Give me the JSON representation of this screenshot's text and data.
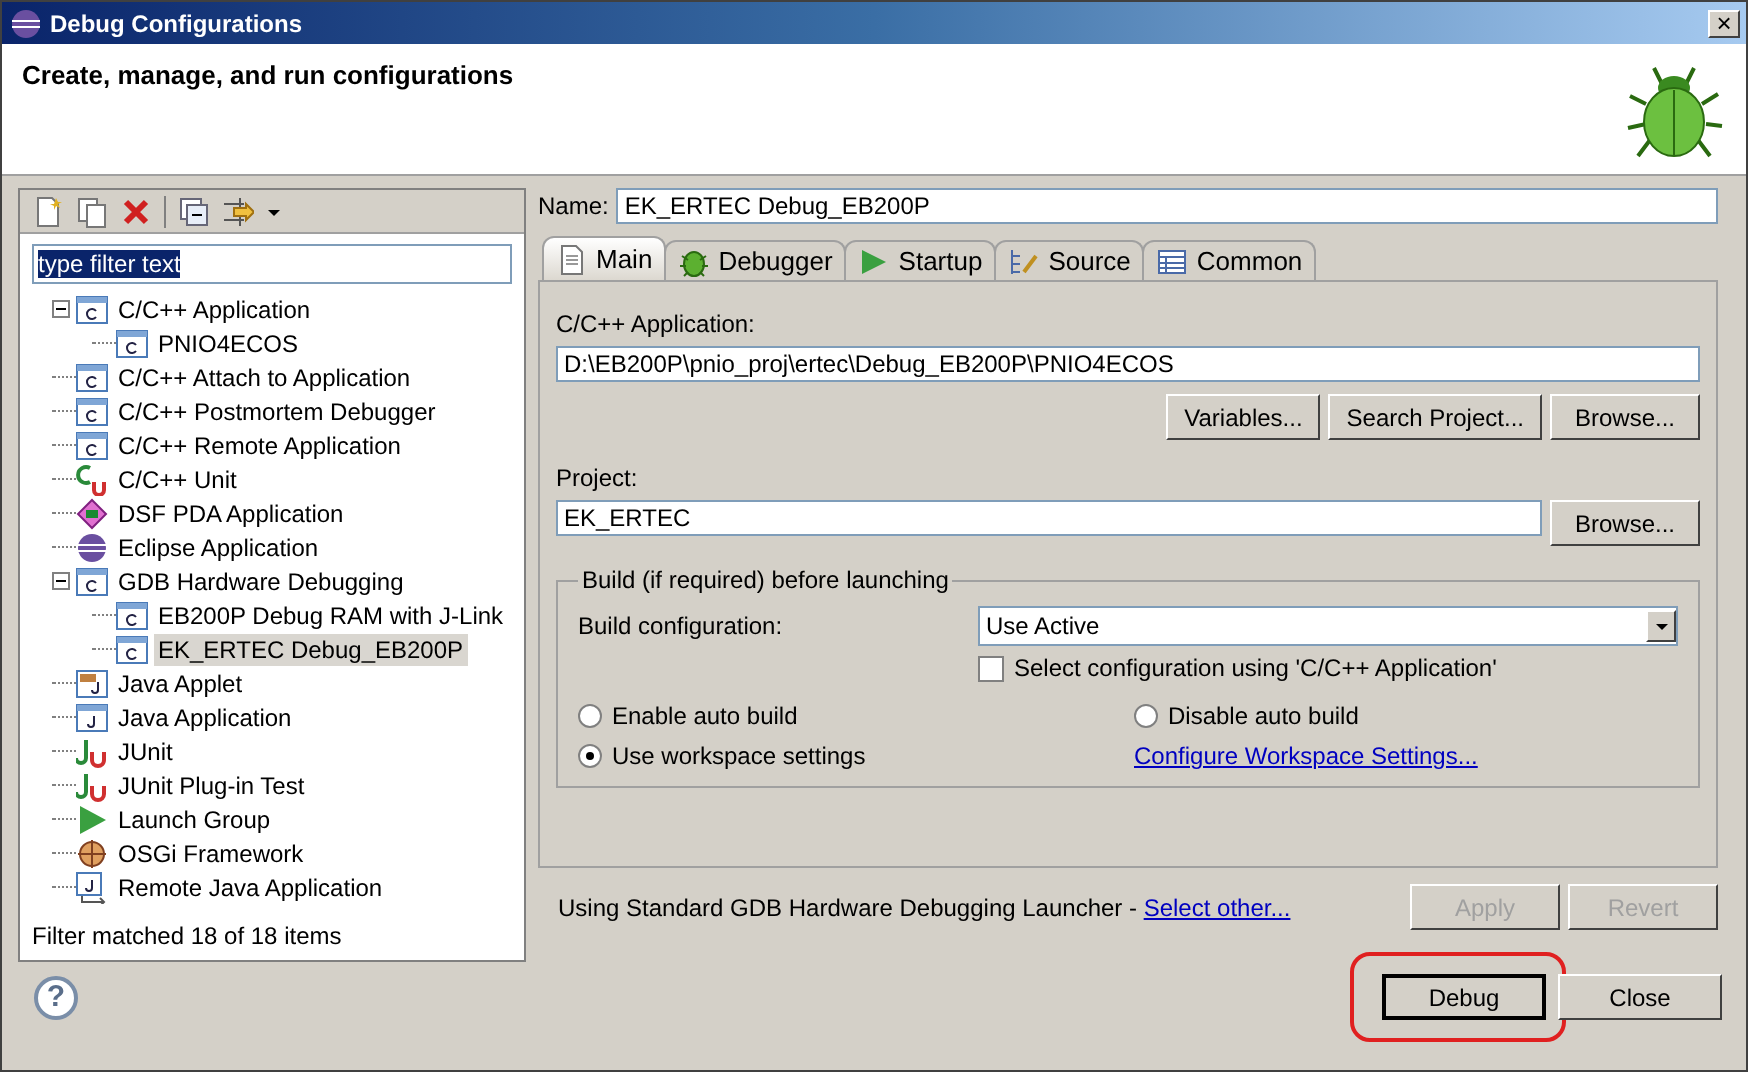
{
  "window": {
    "title": "Debug Configurations",
    "close": "×"
  },
  "header": {
    "title": "Create, manage, and run configurations"
  },
  "filter": {
    "value": "type filter text"
  },
  "tree": {
    "items": [
      {
        "label": "C/C++ Application",
        "kind": "c",
        "expanded": true,
        "selected": false,
        "children": [
          {
            "label": "PNIO4ECOS",
            "kind": "c",
            "selected": false
          }
        ]
      },
      {
        "label": "C/C++ Attach to Application",
        "kind": "c",
        "selected": false
      },
      {
        "label": "C/C++ Postmortem Debugger",
        "kind": "c",
        "selected": false
      },
      {
        "label": "C/C++ Remote Application",
        "kind": "c",
        "selected": false
      },
      {
        "label": "C/C++ Unit",
        "kind": "cunit",
        "selected": false
      },
      {
        "label": "DSF PDA Application",
        "kind": "dsf",
        "selected": false
      },
      {
        "label": "Eclipse Application",
        "kind": "eclipse",
        "selected": false
      },
      {
        "label": "GDB Hardware Debugging",
        "kind": "c",
        "expanded": true,
        "selected": false,
        "children": [
          {
            "label": "EB200P Debug RAM with J-Link",
            "kind": "c",
            "selected": false
          },
          {
            "label": "EK_ERTEC Debug_EB200P",
            "kind": "c",
            "selected": true
          }
        ]
      },
      {
        "label": "Java Applet",
        "kind": "applet",
        "selected": false
      },
      {
        "label": "Java Application",
        "kind": "java",
        "selected": false
      },
      {
        "label": "JUnit",
        "kind": "junit",
        "selected": false
      },
      {
        "label": "JUnit Plug-in Test",
        "kind": "junit",
        "selected": false
      },
      {
        "label": "Launch Group",
        "kind": "launch",
        "selected": false
      },
      {
        "label": "OSGi Framework",
        "kind": "osgi",
        "selected": false
      },
      {
        "label": "Remote Java Application",
        "kind": "remote",
        "selected": false
      }
    ]
  },
  "filter_status": "Filter matched 18 of 18 items",
  "name": {
    "label": "Name:",
    "value": "EK_ERTEC Debug_EB200P"
  },
  "tabs": [
    {
      "label": "Main",
      "kind": "main",
      "selected": true
    },
    {
      "label": "Debugger",
      "kind": "debugger",
      "selected": false
    },
    {
      "label": "Startup",
      "kind": "startup",
      "selected": false
    },
    {
      "label": "Source",
      "kind": "source",
      "selected": false
    },
    {
      "label": "Common",
      "kind": "common",
      "selected": false
    }
  ],
  "main": {
    "app_label": "C/C++ Application:",
    "app_value": "D:\\EB200P\\pnio_proj\\ertec\\Debug_EB200P\\PNIO4ECOS",
    "app_buttons": [
      "Variables...",
      "Search Project...",
      "Browse..."
    ],
    "project_label": "Project:",
    "project_value": "EK_ERTEC",
    "project_button": "Browse...",
    "build": {
      "title": "Build (if required) before launching",
      "config_label": "Build configuration:",
      "config_value": "Use Active",
      "select_config": {
        "label": "Select configuration using 'C/C++ Application'",
        "checked": false
      },
      "radios": [
        {
          "label": "Enable auto build",
          "selected": false
        },
        {
          "label": "Disable auto build",
          "selected": false
        },
        {
          "label": "Use workspace settings",
          "selected": true
        }
      ],
      "link": "Configure Workspace Settings..."
    }
  },
  "launcher": {
    "text": "Using Standard GDB Hardware Debugging Launcher - ",
    "link": "Select other..."
  },
  "panel_buttons": [
    {
      "label": "Apply",
      "disabled": true
    },
    {
      "label": "Revert",
      "disabled": true
    }
  ],
  "help": "?",
  "dialog_buttons": [
    {
      "label": "Debug",
      "highlighted": true
    },
    {
      "label": "Close",
      "highlighted": false
    }
  ]
}
